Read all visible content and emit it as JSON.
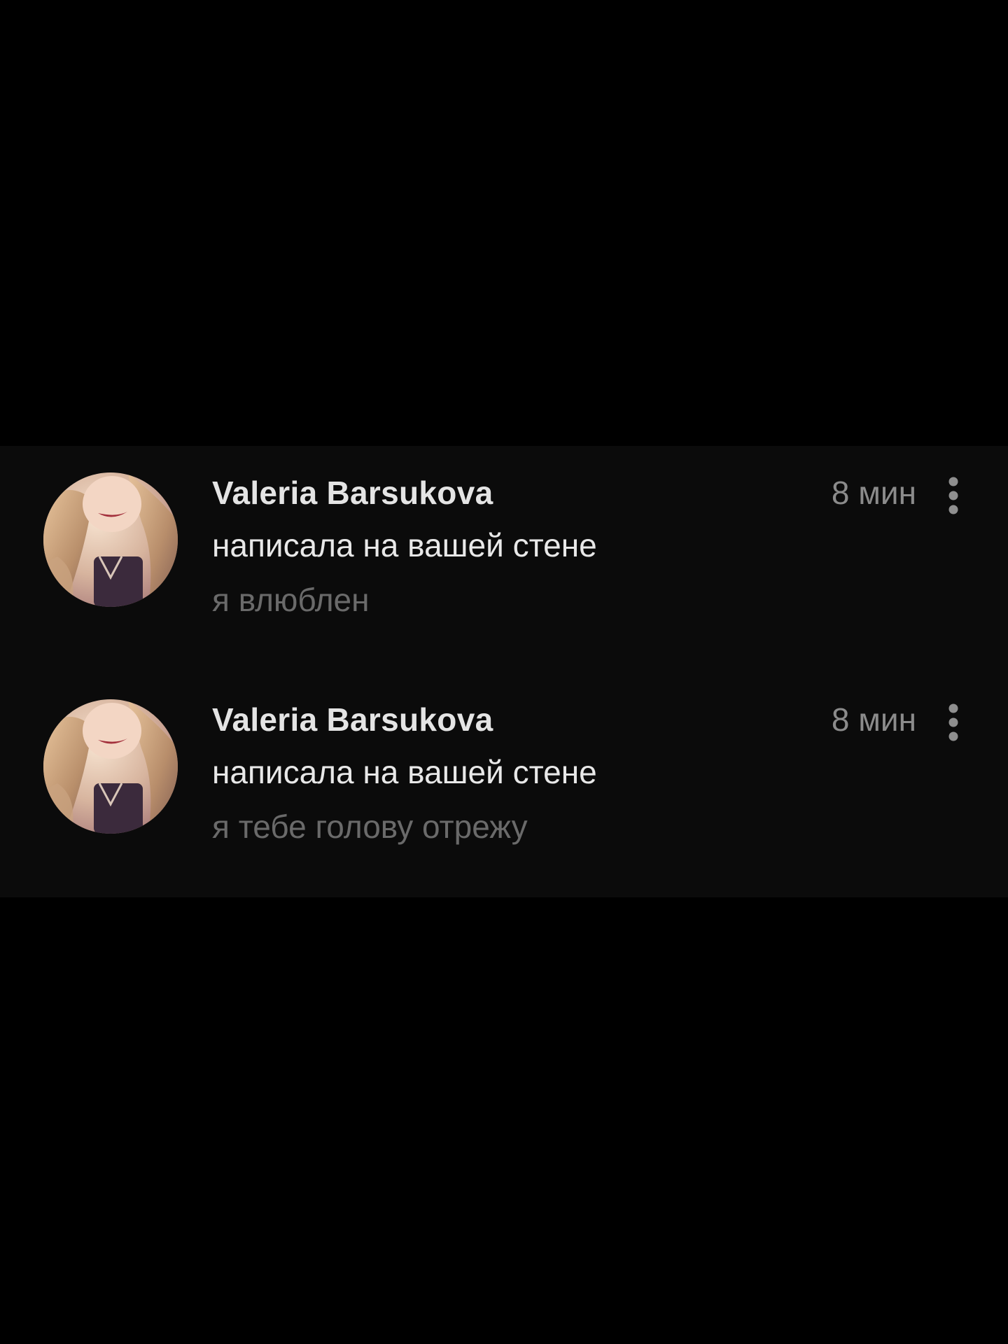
{
  "notifications": [
    {
      "author": "Valeria Barsukova",
      "action": "написала на вашей стене",
      "preview": "я влюблен",
      "time": "8 мин"
    },
    {
      "author": "Valeria Barsukova",
      "action": "написала на вашей стене",
      "preview": "я тебе голову отрежу",
      "time": "8 мин"
    }
  ],
  "icons": {
    "more": "more-vertical-icon",
    "avatar": "avatar-photo"
  },
  "colors": {
    "background": "#000000",
    "panel": "#0b0b0b",
    "name": "#e4e4e4",
    "action": "#e8e8e8",
    "preview": "#6a6a6a",
    "time": "#8b8b8b"
  }
}
